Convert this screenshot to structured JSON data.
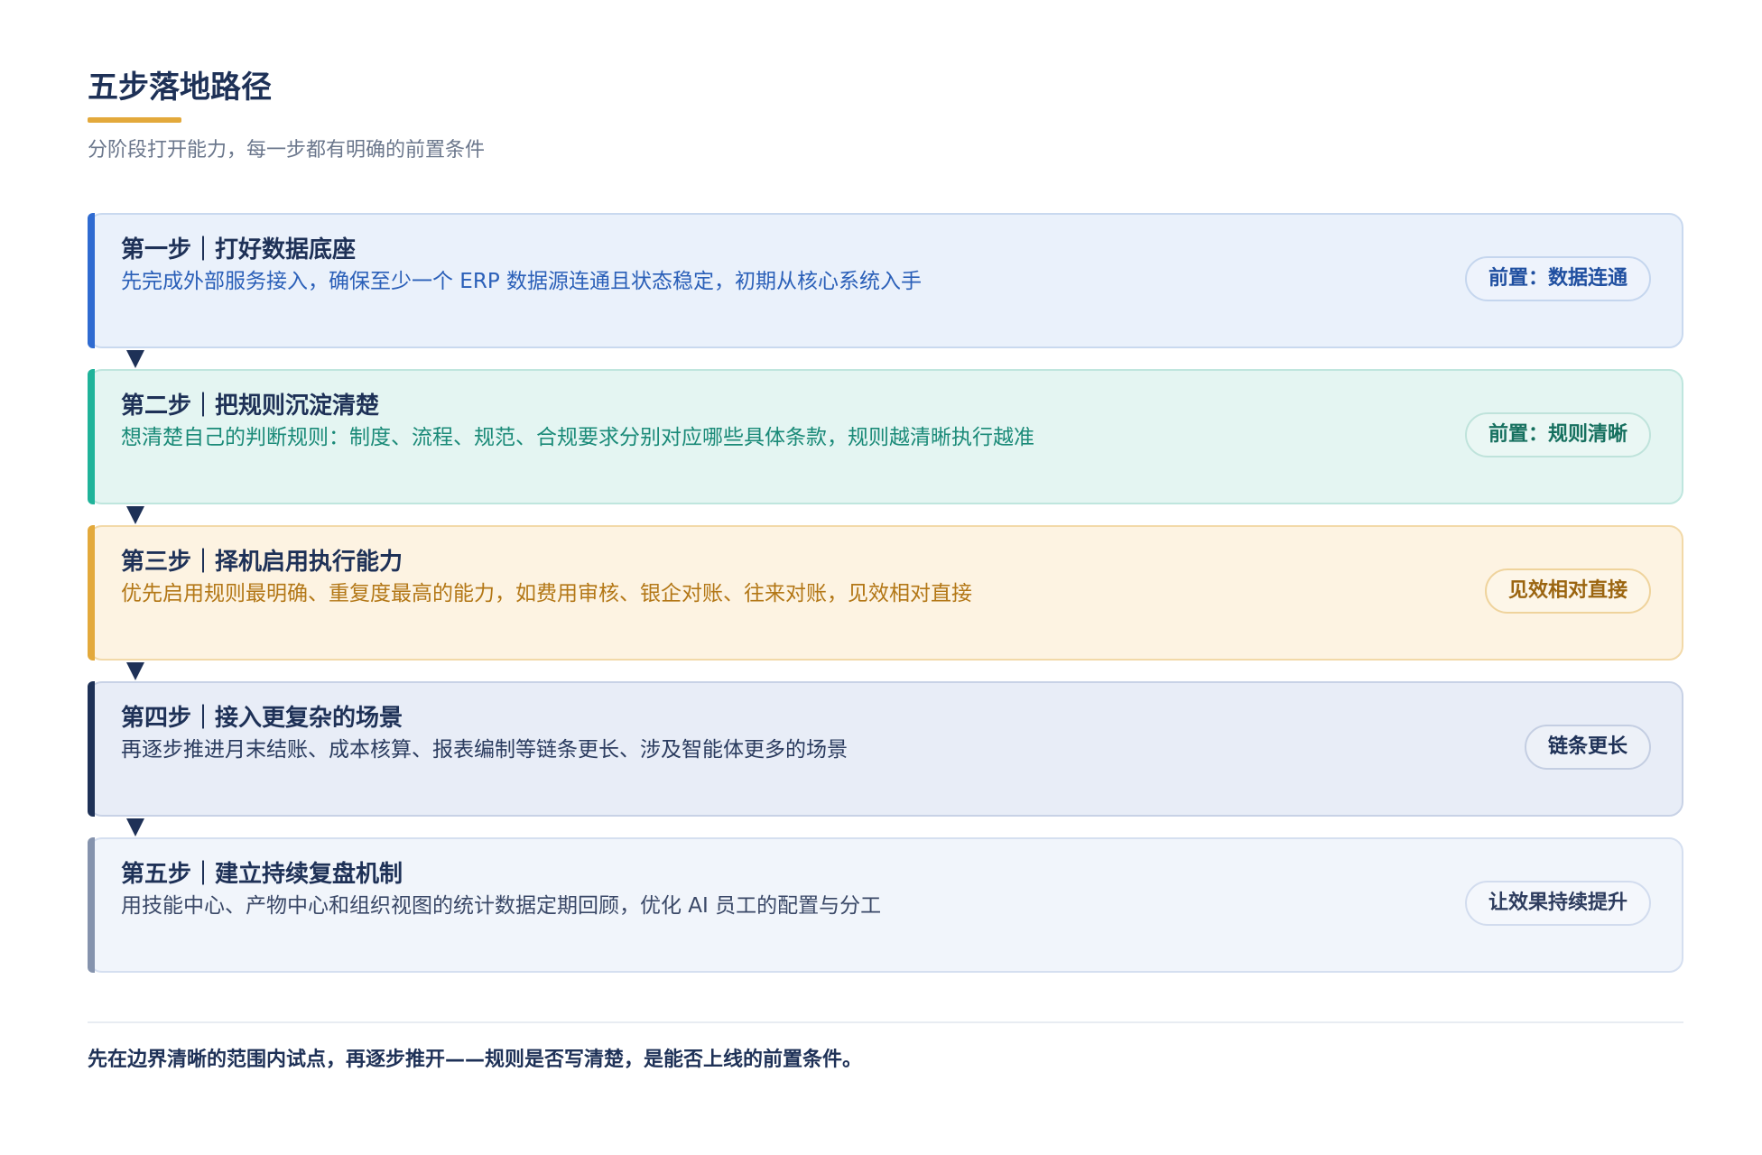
{
  "header": {
    "title": "五步落地路径",
    "subtitle": "分阶段打开能力，每一步都有明确的前置条件"
  },
  "steps": [
    {
      "title": "第一步｜打好数据底座",
      "desc": "先完成外部服务接入，确保至少一个 ERP 数据源连通且状态稳定，初期从核心系统入手",
      "tag": "前置：数据连通"
    },
    {
      "title": "第二步｜把规则沉淀清楚",
      "desc": "想清楚自己的判断规则：制度、流程、规范、合规要求分别对应哪些具体条款，规则越清晰执行越准",
      "tag": "前置：规则清晰"
    },
    {
      "title": "第三步｜择机启用执行能力",
      "desc": "优先启用规则最明确、重复度最高的能力，如费用审核、银企对账、往来对账，见效相对直接",
      "tag": "见效相对直接"
    },
    {
      "title": "第四步｜接入更复杂的场景",
      "desc": "再逐步推进月末结账、成本核算、报表编制等链条更长、涉及智能体更多的场景",
      "tag": "链条更长"
    },
    {
      "title": "第五步｜建立持续复盘机制",
      "desc": "用技能中心、产物中心和组织视图的统计数据定期回顾，优化 AI 员工的配置与分工",
      "tag": "让效果持续提升"
    }
  ],
  "footer": {
    "text": "先在边界清晰的范围内试点，再逐步推开——规则是否写清楚，是能否上线的前置条件。"
  },
  "colors": {
    "accent": "#e3a93b",
    "navy": "#1e3157",
    "step1": "#2f6bd1",
    "step2": "#1fb39a",
    "step3": "#e3a93b",
    "step4": "#1e3157",
    "step5": "#8593ad"
  }
}
